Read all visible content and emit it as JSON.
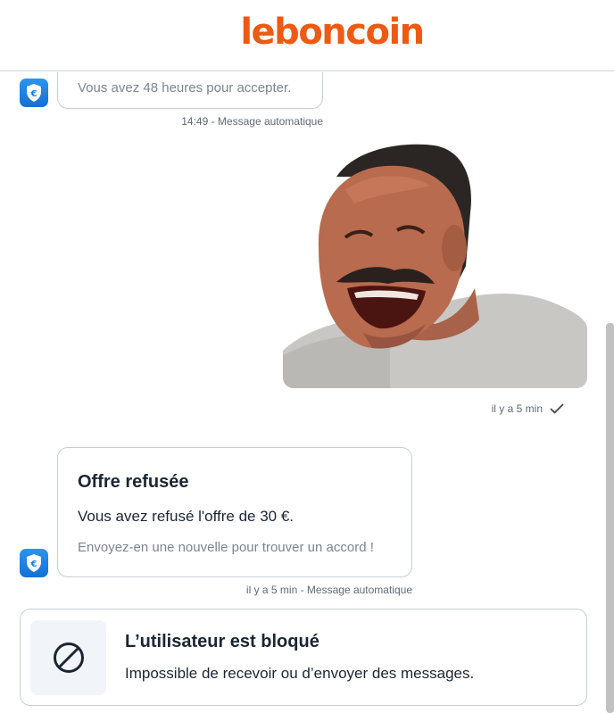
{
  "brand": {
    "logo_text": "leboncoin",
    "color": "#ec5a13"
  },
  "messages": [
    {
      "type": "system",
      "text": "Vous avez 48 heures pour accepter.",
      "time": "14:49 - Message automatique",
      "icon": "shield-euro-icon"
    },
    {
      "type": "image",
      "description": "laughing man meme",
      "time": "il y a 5 min",
      "status_icon": "checkmark-icon"
    },
    {
      "type": "system",
      "title": "Offre refusée",
      "text": "Vous avez refusé l'offre de 30 €.",
      "hint": "Envoyez-en une nouvelle pour trouver un accord !",
      "time": "il y a 5 min - Message automatique",
      "icon": "shield-euro-icon"
    }
  ],
  "blocked": {
    "title": "L’utilisateur est bloqué",
    "description": "Impossible de recevoir ou d’envoyer des messages.",
    "icon": "blocked-icon"
  },
  "colors": {
    "accent_blue": "#1a7be0",
    "border": "#c9ced4",
    "muted_text": "#7b8591"
  }
}
